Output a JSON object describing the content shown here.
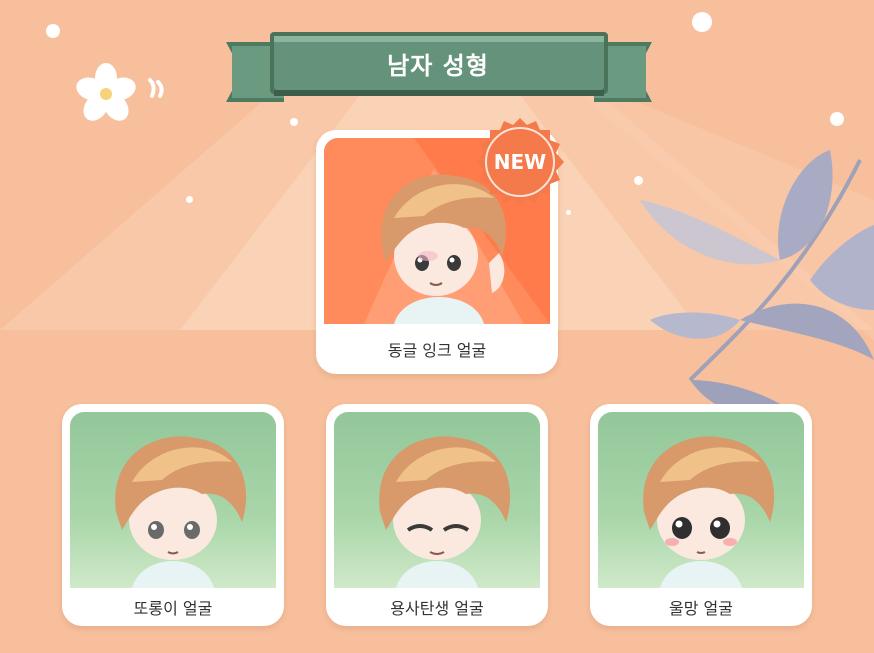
{
  "banner": {
    "title": "남자 성형"
  },
  "featured": {
    "badge": "NEW",
    "label": "동글 잉크 얼굴"
  },
  "faces": [
    {
      "label": "또롱이 얼굴",
      "eyes": "round-gray"
    },
    {
      "label": "용사탄생 얼굴",
      "eyes": "closed-smile"
    },
    {
      "label": "울망 얼굴",
      "eyes": "teary-big"
    }
  ],
  "colors": {
    "background": "#f7bf9c",
    "banner_green": "#5f8f74",
    "featured_bg": "#ff7b4c",
    "card_green": "#9dce9f",
    "badge": "#f47a4c",
    "leaf": "#b3b5cb"
  }
}
